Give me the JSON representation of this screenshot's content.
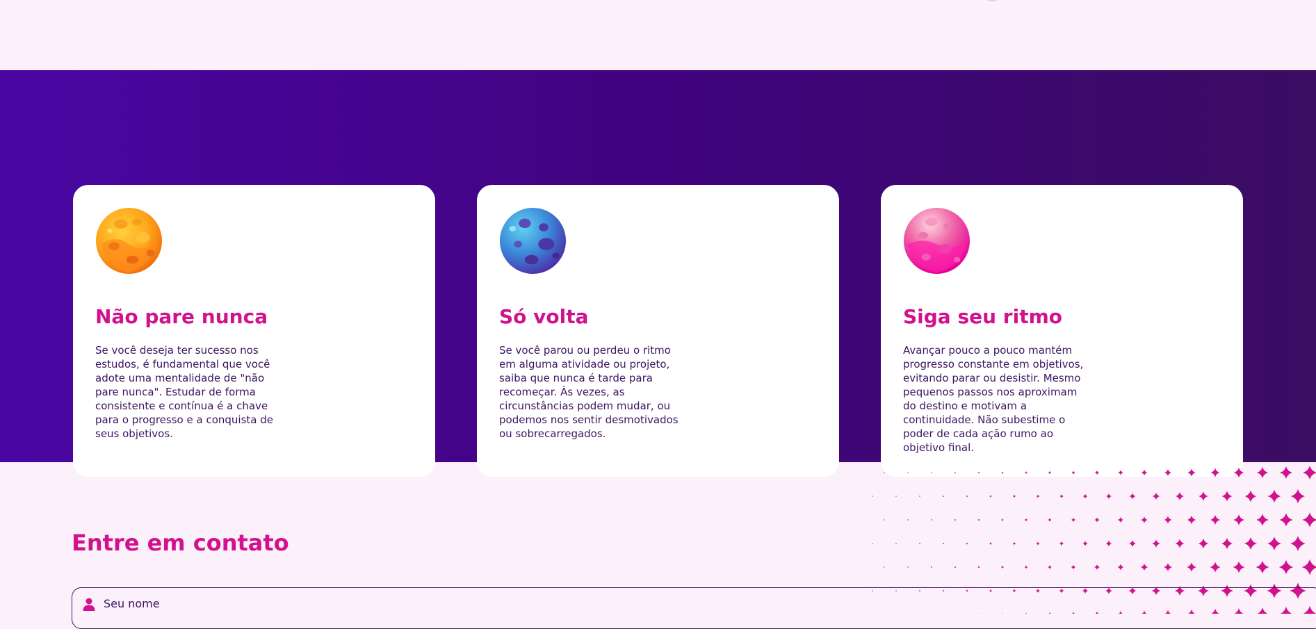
{
  "cards": [
    {
      "title": "Não pare nunca",
      "text": "Se você deseja ter sucesso nos estudos, é fundamental que você adote uma mentalidade de \"não pare nunca\". Estudar de forma consistente e contínua é a chave para o progresso e a conquista de seus objetivos.",
      "icon": "orange-planet-icon"
    },
    {
      "title": "Só volta",
      "text": "Se você parou ou perdeu o ritmo em alguma atividade ou projeto, saiba que nunca é tarde para recomeçar. Às vezes, as circunstâncias podem mudar, ou podemos nos sentir desmotivados ou sobrecarregados.",
      "icon": "blue-planet-icon"
    },
    {
      "title": "Siga seu ritmo",
      "text": "Avançar pouco a pouco mantém progresso constante em objetivos, evitando parar ou desistir. Mesmo pequenos passos nos aproximam do destino e motivam a continuidade. Não subestime o poder de cada ação rumo ao objetivo final.",
      "icon": "pink-planet-icon"
    }
  ],
  "contact": {
    "title": "Entre em contato",
    "name_label": "Seu nome",
    "name_icon": "person-icon"
  },
  "colors": {
    "accent": "#d1128e",
    "text": "#3c1560",
    "band_start": "#4a06a3",
    "band_end": "#3b0d63",
    "page_bg": "#fcf0fa"
  }
}
